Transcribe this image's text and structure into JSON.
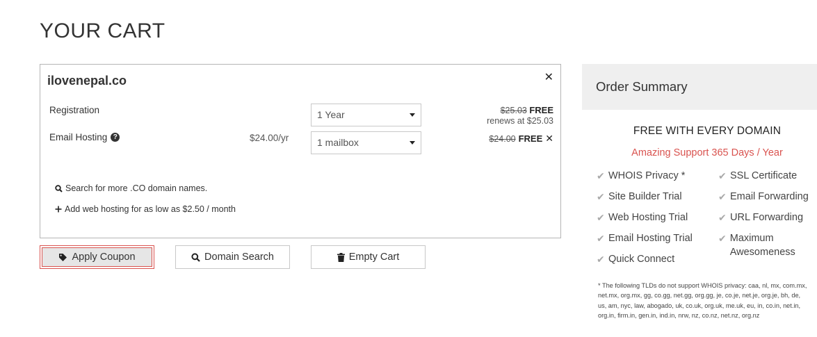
{
  "page": {
    "title": "YOUR CART"
  },
  "cart": {
    "domain": "ilovenepal.co",
    "remove_symbol": "✕",
    "rows": {
      "registration": {
        "label": "Registration",
        "select_value": "1 Year",
        "old_price": "$25.03",
        "free": "FREE",
        "renews": "renews at $25.03"
      },
      "email": {
        "label": "Email Hosting",
        "help_icon": "?",
        "price_per_year": "$24.00/yr",
        "select_value": "1 mailbox",
        "old_price": "$24.00",
        "free": "FREE",
        "remove_symbol": "✕"
      }
    },
    "links": {
      "search_more": "Search for more .CO domain names.",
      "add_hosting": "Add web hosting for as low as $2.50 / month"
    }
  },
  "buttons": {
    "apply_coupon": "Apply Coupon",
    "domain_search": "Domain Search",
    "empty_cart": "Empty Cart"
  },
  "summary": {
    "title": "Order Summary",
    "free_title": "FREE WITH EVERY DOMAIN",
    "support": "Amazing Support 365 Days / Year",
    "features_left": [
      "WHOIS Privacy *",
      "Site Builder Trial",
      "Web Hosting Trial",
      "Email Hosting Trial",
      "Quick Connect"
    ],
    "features_right": [
      "SSL Certificate",
      "Email Forwarding",
      "URL Forwarding",
      "Maximum Awesomeness"
    ],
    "footnote": "* The following TLDs do not support WHOIS privacy: caa, nl, mx, com.mx, net.mx, org.mx, gg, co.gg, net.gg, org.gg, je, co.je, net.je, org.je, bh, de, us, am, nyc, law, abogado, uk, co.uk, org.uk, me.uk, eu, in, co.in, net.in, org.in, firm.in, gen.in, ind.in, nrw, nz, co.nz, net.nz, org.nz"
  },
  "colors": {
    "accent_red": "#d9534f",
    "summary_bg": "#efefef",
    "check_grey": "#aaaaaa"
  }
}
